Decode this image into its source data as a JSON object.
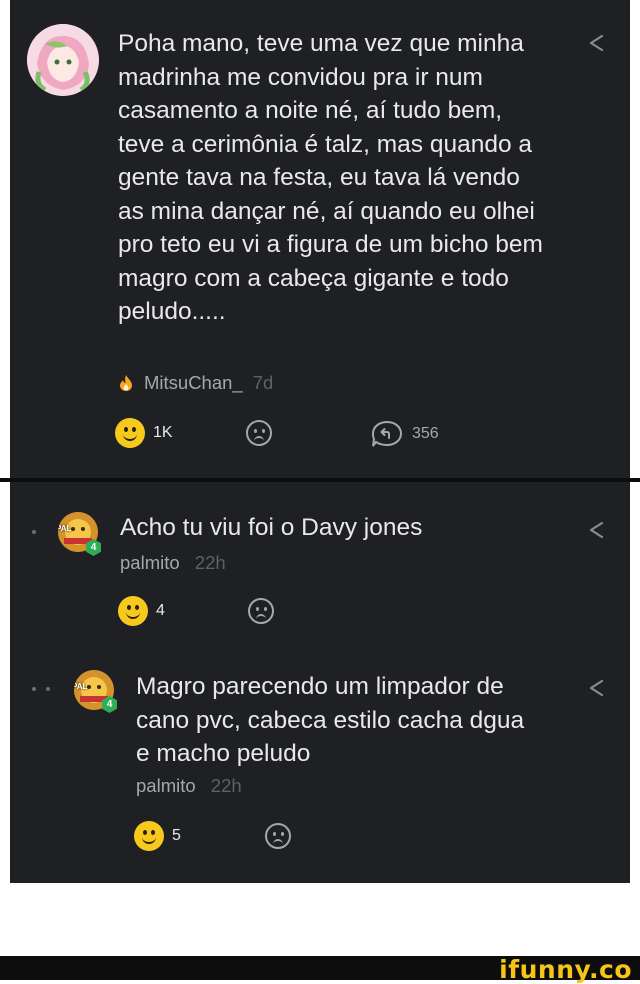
{
  "comments": [
    {
      "text": "Poha mano, teve uma vez que minha madrinha me convidou pra ir num casamento a noite né, aí tudo bem, teve a cerimônia é talz, mas quando a gente tava na festa, eu tava lá vendo as mina dançar né, aí quando eu olhei pro teto eu vi a figura de um bicho bem magro com a cabeça gigante e todo peludo.....",
      "author": "MitsuChan_",
      "time": "7d",
      "smile_count": "1K",
      "reply_count": "356",
      "author_icon": "flame-icon",
      "accent": "#f5a623"
    },
    {
      "text": "Acho tu viu foi o Davy jones",
      "author": "palmito",
      "time": "22h",
      "smile_count": "4",
      "avatar_label": "PAL",
      "level": "4"
    },
    {
      "text": "Magro parecendo um limpador de cano pvc, cabeca estilo cacha dgua e macho peludo",
      "author": "palmito",
      "time": "22h",
      "smile_count": "5",
      "avatar_label": "PAL",
      "level": "4"
    }
  ],
  "brand": {
    "text": "ifunny.co",
    "color": "#f5c518"
  },
  "colors": {
    "panel_bg": "#1f2023",
    "text": "#e9e9ea",
    "muted": "#a6a7ab",
    "smile": "#f7c91c",
    "badge": "#2fae58"
  }
}
